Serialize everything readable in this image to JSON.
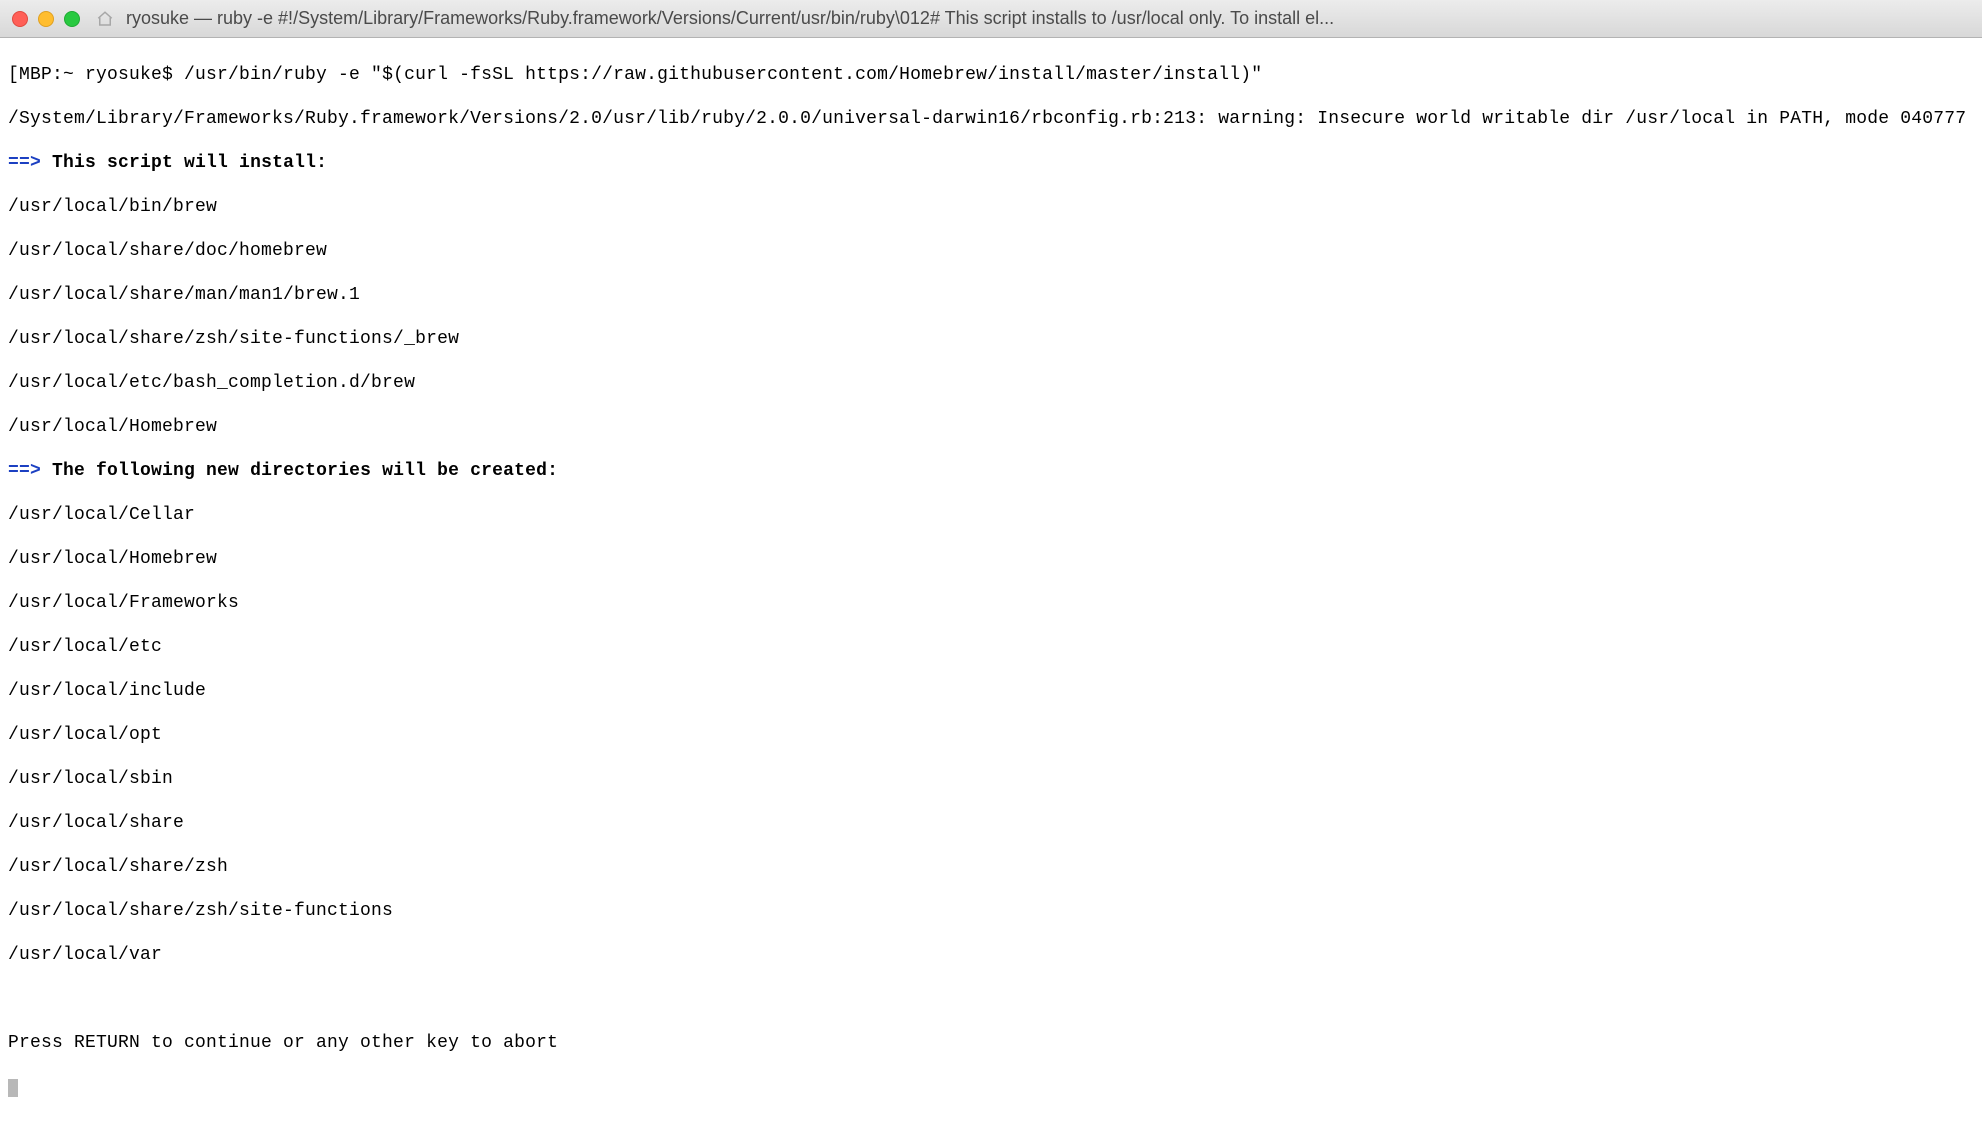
{
  "titlebar": {
    "title": "ryosuke — ruby -e #!/System/Library/Frameworks/Ruby.framework/Versions/Current/usr/bin/ruby\\012# This script installs to /usr/local only. To install el..."
  },
  "terminal": {
    "prompt": "[MBP:~ ryosuke$ ",
    "command": "/usr/bin/ruby -e \"$(curl -fsSL https://raw.githubusercontent.com/Homebrew/install/master/install)\"",
    "warning": "/System/Library/Frameworks/Ruby.framework/Versions/2.0/usr/lib/ruby/2.0.0/universal-darwin16/rbconfig.rb:213: warning: Insecure world writable dir /usr/local in PATH, mode 040777",
    "arrow": "==>",
    "heading1": "This script will install:",
    "install_paths": [
      "/usr/local/bin/brew",
      "/usr/local/share/doc/homebrew",
      "/usr/local/share/man/man1/brew.1",
      "/usr/local/share/zsh/site-functions/_brew",
      "/usr/local/etc/bash_completion.d/brew",
      "/usr/local/Homebrew"
    ],
    "heading2": "The following new directories will be created:",
    "new_dirs": [
      "/usr/local/Cellar",
      "/usr/local/Homebrew",
      "/usr/local/Frameworks",
      "/usr/local/etc",
      "/usr/local/include",
      "/usr/local/opt",
      "/usr/local/sbin",
      "/usr/local/share",
      "/usr/local/share/zsh",
      "/usr/local/share/zsh/site-functions",
      "/usr/local/var"
    ],
    "press_return": "Press RETURN to continue or any other key to abort"
  }
}
